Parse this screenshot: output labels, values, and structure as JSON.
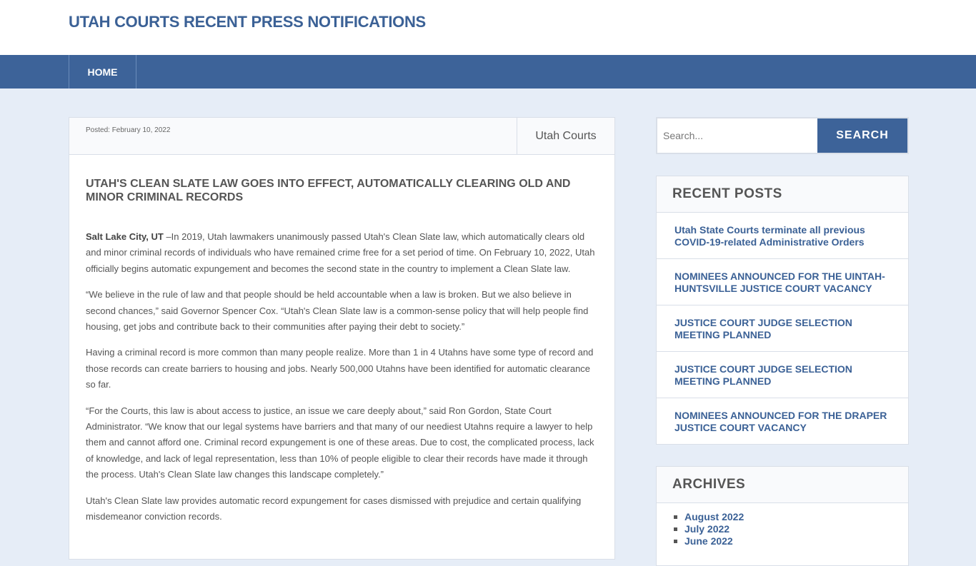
{
  "site": {
    "title": "UTAH COURTS RECENT PRESS NOTIFICATIONS"
  },
  "nav": {
    "home_label": "HOME"
  },
  "article": {
    "posted": "Posted: February 10, 2022",
    "author": "Utah Courts",
    "title": "Utah's Clean Slate Law Goes Into Effect, Automatically Clearing Old and Minor Criminal Records",
    "p1_lead": "Salt Lake City, UT",
    "p1_text": " –In 2019, Utah lawmakers unanimously passed Utah's Clean Slate law, which automatically clears old and minor criminal records of individuals who have remained crime free for a set period of time. On February 10, 2022, Utah officially begins automatic expungement and becomes the second state in the country to implement a Clean Slate law.",
    "p2": "“We believe in the rule of law and that people should be held accountable when a law is broken. But we also believe in second chances,” said Governor Spencer Cox. “Utah's Clean Slate law is a common-sense policy that will help people find housing, get jobs and contribute back to their communities after paying their debt to society.”",
    "p3": "Having a criminal record is more common than many people realize. More than 1 in 4 Utahns have some type of record and those records can create barriers to housing and jobs. Nearly 500,000 Utahns have been identified for automatic clearance so far.",
    "p4": "“For the Courts, this law is about access to justice, an issue we care deeply about,” said Ron Gordon, State Court Administrator. “We know that our legal systems have barriers and that many of our neediest Utahns require a lawyer to help them and cannot afford one. Criminal record expungement is one of these areas. Due to cost, the complicated process, lack of knowledge, and lack of legal representation, less than 10% of people eligible to clear their records have made it through the process. Utah's Clean Slate law changes this landscape completely.”",
    "p5": "Utah's Clean Slate law provides automatic record expungement for cases dismissed with prejudice and certain qualifying misdemeanor conviction records."
  },
  "search": {
    "placeholder": "Search...",
    "button_label": "SEARCH"
  },
  "recent_posts": {
    "title": "RECENT POSTS",
    "items": [
      "Utah State Courts terminate all previous COVID-19-related Administrative Orders",
      "NOMINEES ANNOUNCED FOR THE UINTAH-HUNTSVILLE JUSTICE COURT VACANCY",
      "JUSTICE COURT JUDGE SELECTION MEETING PLANNED",
      "JUSTICE COURT JUDGE SELECTION MEETING PLANNED",
      "NOMINEES ANNOUNCED FOR THE DRAPER JUSTICE COURT VACANCY"
    ]
  },
  "archives": {
    "title": "ARCHIVES",
    "items": [
      "August 2022",
      "July 2022",
      "June 2022"
    ]
  }
}
